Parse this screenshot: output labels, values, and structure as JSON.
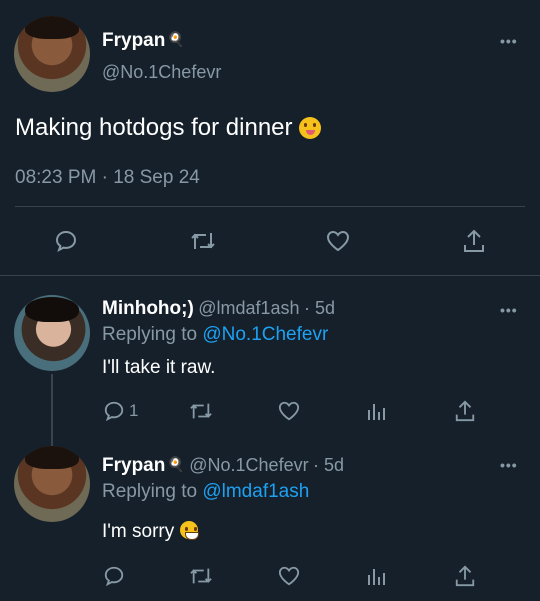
{
  "main_tweet": {
    "name": "Frypan",
    "handle": "@No.1Chefevr",
    "text": "Making hotdogs for dinner",
    "timestamp": "08:23 PM · 18 Sep 24",
    "name_icon": "frying-pan-icon",
    "text_emoji": "yum-emoji"
  },
  "reply1": {
    "name": "Minhoho;)",
    "handle": "@lmdaf1ash",
    "time": "· 5d",
    "replying_prefix": "Replying to",
    "replying_to": "@No.1Chefevr",
    "text": "I'll take it raw.",
    "reply_count": "1"
  },
  "reply2": {
    "name": "Frypan",
    "handle": "@No.1Chefevr",
    "time": "· 5d",
    "replying_prefix": "Replying to",
    "replying_to": "@lmdaf1ash",
    "text": "I'm sorry",
    "text_emoji": "grin-emoji"
  },
  "colors": {
    "background": "#15202b",
    "muted": "#8899a6",
    "link": "#1da1f2",
    "divider": "#38444d"
  }
}
